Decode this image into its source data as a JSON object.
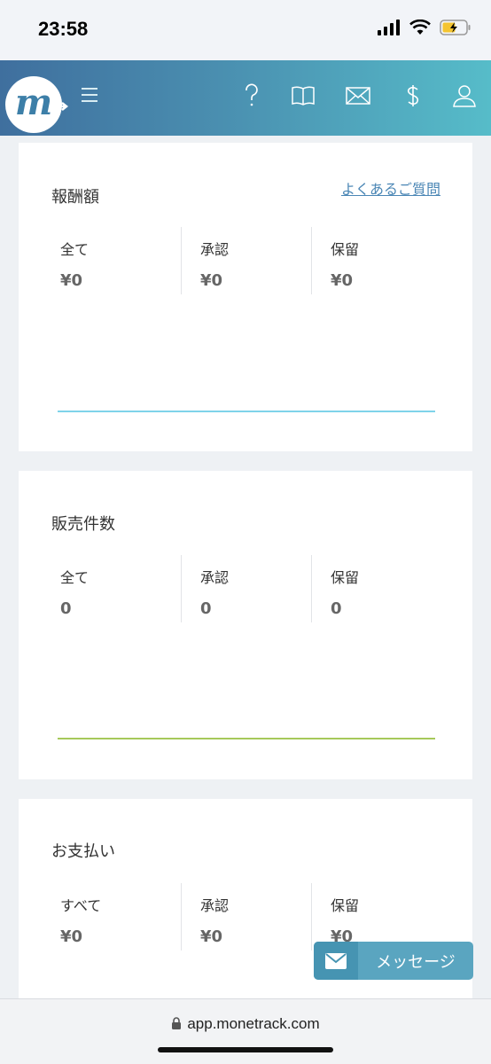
{
  "status_bar": {
    "time": "23:58"
  },
  "header": {
    "logo_letter": "m",
    "icons": [
      "help-icon",
      "book-icon",
      "mail-icon",
      "dollar-icon",
      "user-icon"
    ],
    "gradient_colors": [
      "#3f6f9e",
      "#56bcc9"
    ]
  },
  "cards": [
    {
      "title": "報酬額",
      "faq_link": "よくあるご質問",
      "stats": [
        {
          "label": "全て",
          "value": "¥0"
        },
        {
          "label": "承認",
          "value": "¥0"
        },
        {
          "label": "保留",
          "value": "¥0"
        }
      ],
      "line_color": "#7fd3ea"
    },
    {
      "title": "販売件数",
      "stats": [
        {
          "label": "全て",
          "value": "0"
        },
        {
          "label": "承認",
          "value": "0"
        },
        {
          "label": "保留",
          "value": "0"
        }
      ],
      "line_color": "#a6c95a"
    },
    {
      "title": "お支払い",
      "stats": [
        {
          "label": "すべて",
          "value": "¥0"
        },
        {
          "label": "承認",
          "value": "¥0"
        },
        {
          "label": "保留",
          "value": "¥0"
        }
      ]
    }
  ],
  "message_button": {
    "label": "メッセージ",
    "color": "#5aa5c0"
  },
  "url_bar": {
    "url": "app.monetrack.com"
  }
}
